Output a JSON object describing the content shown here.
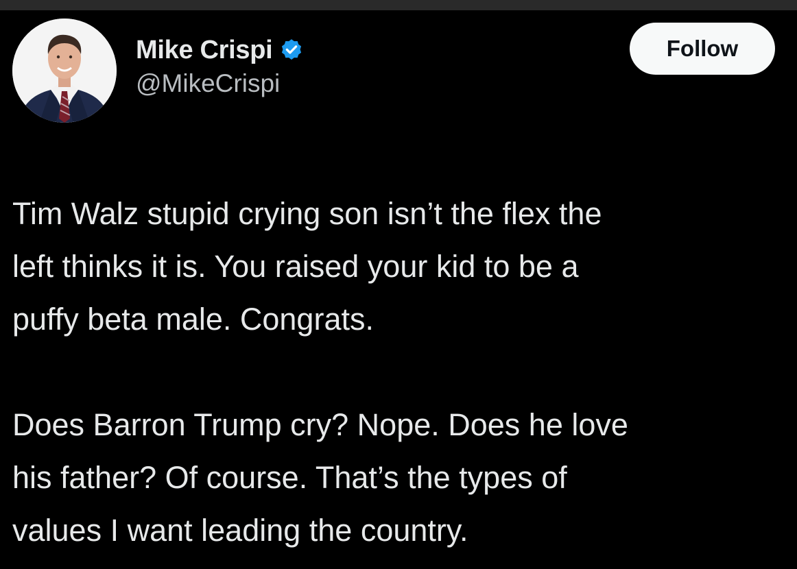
{
  "tweet": {
    "author": {
      "display_name": "Mike Crispi",
      "handle": "@MikeCrispi",
      "verified": true,
      "verified_icon": "verified-badge-icon",
      "avatar_icon": "profile-photo"
    },
    "follow_label": "Follow",
    "paragraphs": [
      "Tim Walz stupid crying son isn’t the flex the\nleft thinks it is. You raised your kid to be a\npuffy beta male. Congrats.",
      "Does Barron Trump cry? Nope. Does he love\nhis father? Of course. That’s the types of\nvalues I want leading the country."
    ]
  },
  "colors": {
    "background": "#000000",
    "text": "#e7e9ea",
    "secondary_text": "#b9bdc1",
    "verified_blue": "#1d9bf0",
    "follow_button_bg": "#f7f9f9",
    "follow_button_text": "#0f1419"
  }
}
